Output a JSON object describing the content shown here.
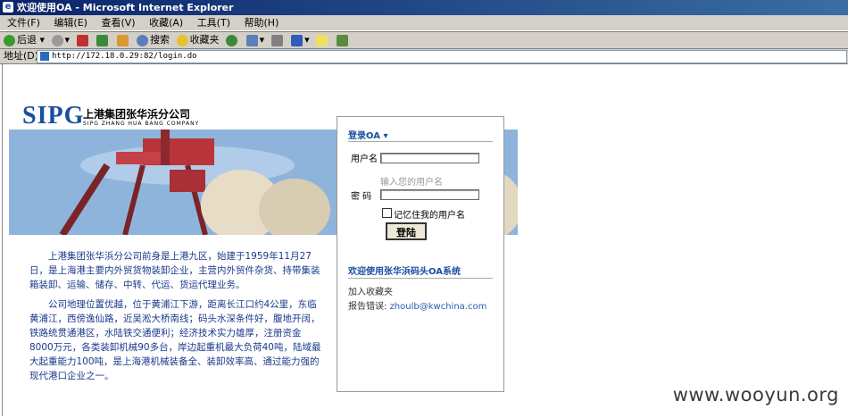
{
  "window": {
    "title": "欢迎使用OA - Microsoft Internet Explorer"
  },
  "menu": [
    "文件(F)",
    "编辑(E)",
    "查看(V)",
    "收藏(A)",
    "工具(T)",
    "帮助(H)"
  ],
  "toolbar": {
    "back": "后退",
    "search": "搜索",
    "favorites": "收藏夹"
  },
  "address": {
    "label": "地址(D)",
    "url": "http://172.18.0.29:82/login.do"
  },
  "logo": {
    "abbr": "SIPG",
    "cn": "上港集团张华浜分公司",
    "en": "SIPG ZHANG HUA BANG COMPANY"
  },
  "intro": {
    "para1": "上港集团张华浜分公司前身是上港九区，始建于1959年11月27日，是上海港主要内外贸货物装卸企业，主营内外贸件杂货、持带集装箱装卸、运输、储存、中转、代运、货运代理业务。",
    "para2": "公司地理位置优越，位于黄浦江下游，距离长江口约4公里，东临黄浦江，西傍逸仙路，近吴淞大桥南线；码头水深条件好，腹地开阔，铁路统贯通港区，水陆铁交通便利；经济技术实力雄厚，注册资金8000万元，各类装卸机械90多台，岸边起重机最大负荷40吨，陆域最大起重能力100吨，是上海港机械装备全、装卸效率高、通过能力强的现代港口企业之一。"
  },
  "login": {
    "header": "登录OA",
    "username_label": "用户名",
    "username_hint": "输入您的用户名",
    "password_label": "密 码",
    "remember_label": "记忆住我的用户名",
    "submit": "登陆",
    "welcome": "欢迎使用张华浜码头OA系统",
    "add_favorite": "加入收藏夹",
    "report_label": "报告错误:",
    "report_email": "zhoulb@kwchina.com"
  },
  "watermark": "www.wooyun.org"
}
